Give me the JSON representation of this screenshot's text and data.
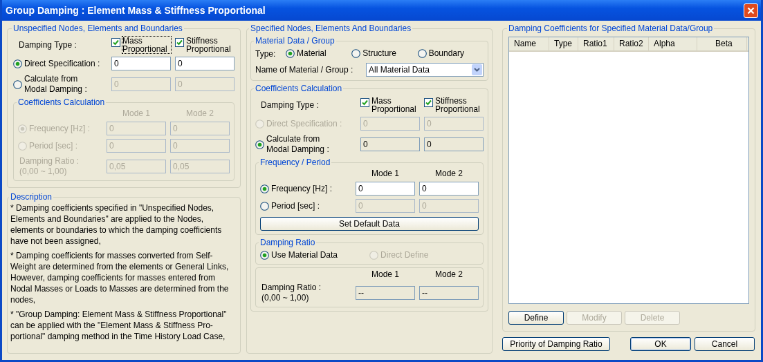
{
  "window": {
    "title": "Group Damping : Element Mass & Stiffness Proportional"
  },
  "unspecified": {
    "title": "Unspecified Nodes, Elements and Boundaries",
    "items": [
      {
        "kind": "checks",
        "label": "Damping Type :",
        "options": [
          {
            "label": "Mass Proportional",
            "checked": true,
            "focused": true
          },
          {
            "label": "Stiffness Proportional",
            "checked": true,
            "focused": false
          }
        ]
      },
      {
        "kind": "radio",
        "label": [
          "Direct Specification :"
        ],
        "selected": true,
        "disabled": false,
        "fields": [
          {
            "value": "0",
            "disabled": false,
            "readonly": false
          },
          {
            "value": "0",
            "disabled": false,
            "readonly": false
          }
        ]
      },
      {
        "kind": "radio",
        "label": [
          "Calculate from",
          "Modal Damping :"
        ],
        "selected": false,
        "disabled": false,
        "fields": [
          {
            "value": "0",
            "disabled": true
          },
          {
            "value": "0",
            "disabled": true
          }
        ]
      },
      {
        "kind": "group",
        "title": "Coefficients Calculation",
        "items": [
          {
            "kind": "header",
            "disabled": true,
            "columns": [
              "Mode 1",
              "Mode 2"
            ]
          },
          {
            "kind": "radio",
            "label": [
              "Frequency [Hz] :"
            ],
            "selected": true,
            "disabled": true,
            "fields": [
              {
                "value": "0",
                "disabled": true
              },
              {
                "value": "0",
                "disabled": true
              }
            ]
          },
          {
            "kind": "radio",
            "label": [
              "Period [sec] :"
            ],
            "selected": false,
            "disabled": true,
            "fields": [
              {
                "value": "0",
                "disabled": true
              },
              {
                "value": "0",
                "disabled": true
              }
            ]
          },
          {
            "kind": "text",
            "label": [
              "Damping Ratio :",
              "(0,00 ~ 1,00)"
            ],
            "disabled": true,
            "fields": [
              {
                "value": "0,05",
                "disabled": true
              },
              {
                "value": "0,05",
                "disabled": true
              }
            ]
          }
        ]
      }
    ]
  },
  "description": {
    "title": "Description",
    "paragraphs": [
      "* Damping coefficients specified in \"Unspecified Nodes, Elements and Boundaries\" are applied to the Nodes, elements or boundaries to which the damping coefficients have not been assigned,",
      "* Damping coefficients for masses converted from Self-Weight are determined from the elements or General Links, However, damping coefficients for masses entered from Nodal Masses or Loads to Masses are determined from the nodes,",
      "* \"Group Damping: Element Mass & Stiffness Proportional\" can be applied with the \"Element Mass & Stiffness Pro-portional\" damping method in the Time History Load Case,"
    ]
  },
  "specified": {
    "title": "Specified Nodes, Elements And Boundaries",
    "items": [
      {
        "kind": "group",
        "title": "Material Data / Group",
        "items": [
          {
            "kind": "choices",
            "label": "Type:",
            "options": [
              {
                "label": "Material",
                "selected": true,
                "disabled": false
              },
              {
                "label": "Structure",
                "selected": false,
                "disabled": false
              },
              {
                "label": "Boundary",
                "selected": false,
                "disabled": false
              }
            ]
          },
          {
            "kind": "select",
            "label": "Name of Material / Group :",
            "value": "All Material Data"
          }
        ]
      },
      {
        "kind": "group",
        "title": "Coefficients Calculation",
        "items": [
          {
            "kind": "checks",
            "label": "Damping Type :",
            "options": [
              {
                "label": "Mass Proportional",
                "checked": true,
                "focused": false
              },
              {
                "label": "Stiffness Proportional",
                "checked": true,
                "focused": false
              }
            ]
          },
          {
            "kind": "radio",
            "label": [
              "Direct Specification :"
            ],
            "selected": false,
            "disabled": true,
            "fields": [
              {
                "value": "0",
                "disabled": true
              },
              {
                "value": "0",
                "disabled": true
              }
            ]
          },
          {
            "kind": "radio",
            "label": [
              "Calculate from",
              "Modal Damping :"
            ],
            "selected": true,
            "disabled": false,
            "fields": [
              {
                "value": "0",
                "disabled": false,
                "readonly": true
              },
              {
                "value": "0",
                "disabled": false,
                "readonly": true
              }
            ]
          },
          {
            "kind": "group",
            "title": "Frequency / Period",
            "items": [
              {
                "kind": "header",
                "disabled": false,
                "columns": [
                  "Mode 1",
                  "Mode 2"
                ]
              },
              {
                "kind": "radio",
                "label": [
                  "Frequency [Hz] :"
                ],
                "selected": true,
                "disabled": false,
                "fields": [
                  {
                    "value": "0",
                    "disabled": false,
                    "readonly": false
                  },
                  {
                    "value": "0",
                    "disabled": false,
                    "readonly": false
                  }
                ]
              },
              {
                "kind": "radio",
                "label": [
                  "Period [sec] :"
                ],
                "selected": false,
                "disabled": false,
                "fields": [
                  {
                    "value": "0",
                    "disabled": true
                  },
                  {
                    "value": "0",
                    "disabled": true
                  }
                ]
              },
              {
                "kind": "button",
                "label": "Set Default Data"
              }
            ]
          },
          {
            "kind": "group",
            "title": "Damping Ratio",
            "items": [
              {
                "kind": "choices",
                "options": [
                  {
                    "label": "Use Material Data",
                    "selected": true,
                    "disabled": false
                  },
                  {
                    "label": "Direct Define",
                    "selected": false,
                    "disabled": true
                  }
                ]
              }
            ]
          },
          {
            "kind": "group",
            "items": [
              {
                "kind": "header",
                "disabled": false,
                "columns": [
                  "Mode 1",
                  "Mode 2"
                ]
              },
              {
                "kind": "text",
                "label": [
                  "Damping Ratio :",
                  "(0,00 ~ 1,00)"
                ],
                "disabled": false,
                "fields": [
                  {
                    "value": "--",
                    "disabled": false,
                    "readonly": true
                  },
                  {
                    "value": "--",
                    "disabled": false,
                    "readonly": true
                  }
                ]
              }
            ]
          }
        ]
      }
    ]
  },
  "coefficients_list": {
    "title": "Damping Coefficients for Specified Material Data/Group",
    "columns": [
      "Name",
      "Type",
      "Ratio1",
      "Ratio2",
      "Alpha",
      "Beta"
    ],
    "buttons": [
      {
        "label": "Define",
        "disabled": false
      },
      {
        "label": "Modify",
        "disabled": true
      },
      {
        "label": "Delete",
        "disabled": true
      }
    ]
  },
  "footer_buttons": [
    {
      "label": "Priority of Damping Ratio",
      "default": false
    },
    {
      "label": "OK",
      "default": true
    },
    {
      "label": "Cancel",
      "default": false
    }
  ]
}
